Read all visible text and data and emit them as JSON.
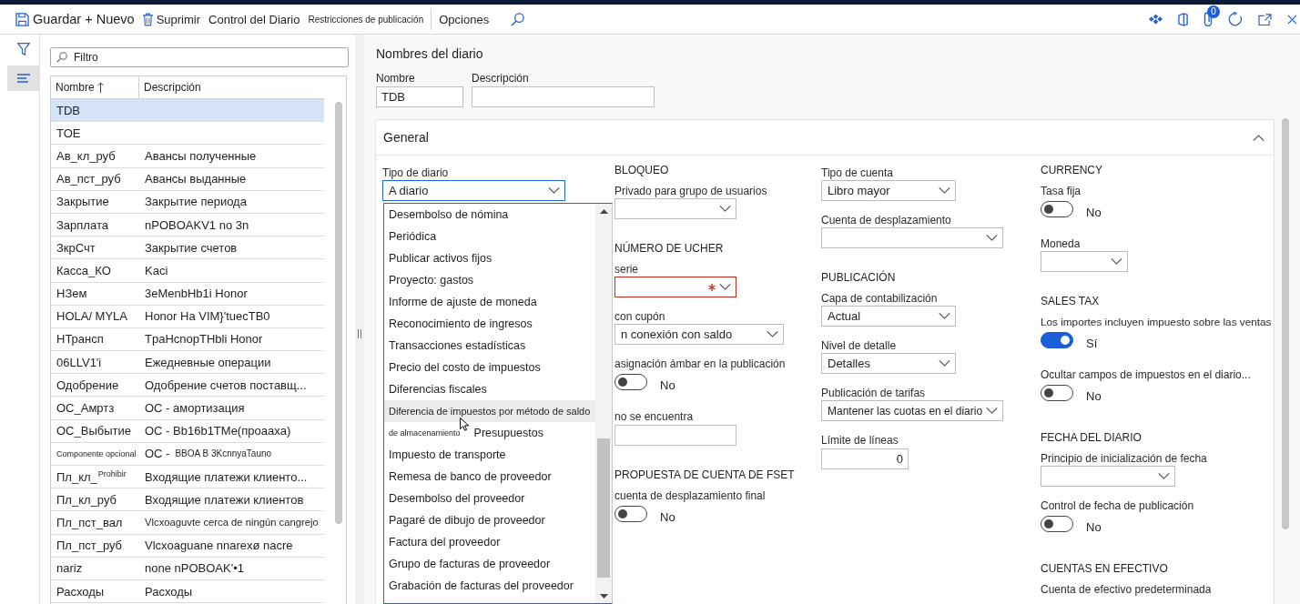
{
  "toolbar": {
    "actions": [
      {
        "kind": "save",
        "label": "Guardar + Nuevo"
      },
      {
        "kind": "delete",
        "label": "Suprimir"
      },
      {
        "kind": "menu",
        "label": "Control del Diario"
      },
      {
        "kind": "menu",
        "label": "Restricciones de publicación"
      },
      {
        "kind": "menu",
        "label": "Opciones"
      }
    ],
    "attachment_count": "0"
  },
  "nav_rail": {
    "items": [
      {
        "kind": "filter",
        "selected": false
      },
      {
        "kind": "list",
        "selected": true
      }
    ]
  },
  "journal_list": {
    "filter_placeholder": "Filtro",
    "columns": [
      {
        "label": "Nombre",
        "sorted": true
      },
      {
        "label": "Descripción",
        "sorted": false
      }
    ],
    "rows": [
      {
        "name": "TDB",
        "selected": true
      },
      {
        "name": "TOE",
        "selected": false
      },
      {
        "name": "Ав_кл_руб",
        "description": "Авансы полученные",
        "selected": false
      },
      {
        "name": "Ав_пст_руб",
        "description": "Авансы выданные",
        "selected": false
      },
      {
        "name": "Закрытие",
        "description": "Закрытие периода",
        "selected": false
      },
      {
        "name": "Зарплата",
        "description": "nPOBOAKV1 no 3n",
        "selected": false
      },
      {
        "name": "ЗкрСчт",
        "description": "Закрытие счетов",
        "selected": false
      },
      {
        "name": "Касса_КО",
        "description": "Kaci",
        "selected": false
      },
      {
        "name": "НЗем",
        "description": "3eMenbHb1i Honor",
        "selected": false
      },
      {
        "name": "HOLA/ MYLA",
        "description": "Honor Ha VIM}'tuecTB0",
        "selected": false
      },
      {
        "name": "НТрансп",
        "description": "TpaHcnopTHbli Honor",
        "selected": false
      },
      {
        "name": "06LLV1'i",
        "description": "Ежедневные операции",
        "selected": false
      },
      {
        "name": "Одобрение",
        "description": "Одобрение счетов поставщ...",
        "selected": false
      },
      {
        "name": "ОС_Амртз",
        "description": "ОС - амортизация",
        "selected": false
      },
      {
        "name": "ОС_Выбытие",
        "description": "OC - Bb16b1TMe(проаахa)",
        "selected": false
      },
      {
        "name": "Componente opcional",
        "description": "OC -",
        "desc_note": "BBOA B 3KcnnyaTauno",
        "selected": false
      },
      {
        "name": "Пл_кл_",
        "name_note": "Prohibir",
        "description": "Входящие платежи клиенто...",
        "selected": false
      },
      {
        "name": "Пл_кл_руб",
        "description": "Входящие платежи клиентов",
        "selected": false
      },
      {
        "name": "Пл_пст_вал",
        "description": "Vlcxoaguvte cerca de ningún cangrejo",
        "selected": false
      },
      {
        "name": "Пл_пст_руб",
        "description": "Vlcxoaguane nnarexø nacre",
        "selected": false
      },
      {
        "name": "nariz",
        "description": "none nPOBOAK'•1",
        "selected": false
      },
      {
        "name": "Расходы",
        "description": "Расходы",
        "selected": false
      }
    ]
  },
  "form": {
    "title": "Nombres del diario",
    "header_fields": [
      {
        "label": "Nombre",
        "value": "TDB"
      },
      {
        "label": "Descripción"
      }
    ],
    "section": {
      "title": "General",
      "expanded": true
    },
    "journal_type": {
      "label": "Tipo de diario",
      "value": "A diario",
      "expanded": true,
      "options": [
        {
          "label": "Desembolso de nómina",
          "hovered": false
        },
        {
          "label": "Periódica",
          "hovered": false
        },
        {
          "label": "Publicar activos fijos",
          "hovered": false
        },
        {
          "label": "Proyecto: gastos",
          "hovered": false
        },
        {
          "label": "Informe de ajuste de moneda",
          "hovered": false
        },
        {
          "label": "Reconocimiento de ingresos",
          "hovered": false
        },
        {
          "label": "Transacciones estadísticas",
          "hovered": false
        },
        {
          "label": "Precio del costo de impuestos",
          "hovered": false
        },
        {
          "label": "Diferencias fiscales",
          "hovered": false
        },
        {
          "label": "Diferencia de impuestos por método de saldo",
          "hovered": true
        },
        {
          "note": "de almacenamiento",
          "label": "Presupuestos",
          "hovered": false
        },
        {
          "label": "Impuesto de transporte",
          "hovered": false
        },
        {
          "label": "Remesa de banco de proveedor",
          "hovered": false
        },
        {
          "label": "Desembolso del proveedor",
          "hovered": false
        },
        {
          "label": "Pagaré de dibujo de proveedor",
          "hovered": false
        },
        {
          "label": "Factura del proveedor",
          "hovered": false
        },
        {
          "label": "Grupo de facturas de proveedor",
          "hovered": false
        },
        {
          "label": "Grabación de facturas del proveedor",
          "hovered": false
        }
      ]
    },
    "columns": [
      {
        "fields": [
          {
            "kind": "heading",
            "text": "BLOQUEO"
          },
          {
            "kind": "select",
            "label": "Privado para grupo de usuarios",
            "required": false
          },
          {
            "kind": "heading",
            "text": "NÚMERO DE UCHER"
          },
          {
            "kind": "select",
            "label": "serie",
            "required": true
          },
          {
            "kind": "select",
            "label": "con cupón",
            "value": "n conexión con saldo",
            "required": false
          },
          {
            "kind": "toggle",
            "label": "asignación ámbar en la publicación",
            "on": false,
            "state_text": "No"
          },
          {
            "kind": "text",
            "label": "no se encuentra"
          },
          {
            "kind": "heading",
            "text": "PROPUESTA DE CUENTA DE FSET"
          },
          {
            "kind": "toggle",
            "label": "cuenta de desplazamiento final",
            "on": false,
            "state_text": "No"
          }
        ]
      },
      {
        "fields": [
          {
            "kind": "select",
            "label": "Tipo de cuenta",
            "value": "Libro mayor",
            "required": false
          },
          {
            "kind": "select",
            "label": "Cuenta de desplazamiento",
            "required": false
          },
          {
            "kind": "heading",
            "text": "PUBLICACIÓN"
          },
          {
            "kind": "select",
            "label": "Capa de contabilización",
            "value": "Actual",
            "required": false
          },
          {
            "kind": "select",
            "label": "Nivel de detalle",
            "value": "Detalles",
            "required": false
          },
          {
            "kind": "select",
            "label": "Publicación de tarifas",
            "value": "Mantener las cuotas en el diario",
            "required": false
          },
          {
            "kind": "number",
            "label": "Límite de líneas",
            "value": "0"
          }
        ]
      },
      {
        "fields": [
          {
            "kind": "heading",
            "text": "CURRENCY"
          },
          {
            "kind": "toggle",
            "label": "Tasa fija",
            "on": false,
            "state_text": "No"
          },
          {
            "kind": "select",
            "label": "Moneda",
            "required": false
          },
          {
            "kind": "heading",
            "text": "SALES TAX"
          },
          {
            "kind": "toggle",
            "label": "Los importes incluyen impuesto sobre las ventas",
            "on": true,
            "state_text": "Sí"
          },
          {
            "kind": "toggle",
            "label": "Ocultar campos de impuestos en el diario...",
            "on": false,
            "state_text": "No"
          },
          {
            "kind": "heading",
            "text": "FECHA DEL DIARIO"
          },
          {
            "kind": "select",
            "label": "Principio de inicialización de fecha",
            "required": false
          },
          {
            "kind": "toggle",
            "label": "Control de fecha de publicación",
            "on": false,
            "state_text": "No"
          },
          {
            "kind": "heading",
            "text": "CUENTAS EN EFECTIVO"
          },
          {
            "kind": "label",
            "label": "Cuenta de efectivo predeterminada"
          }
        ]
      }
    ]
  }
}
